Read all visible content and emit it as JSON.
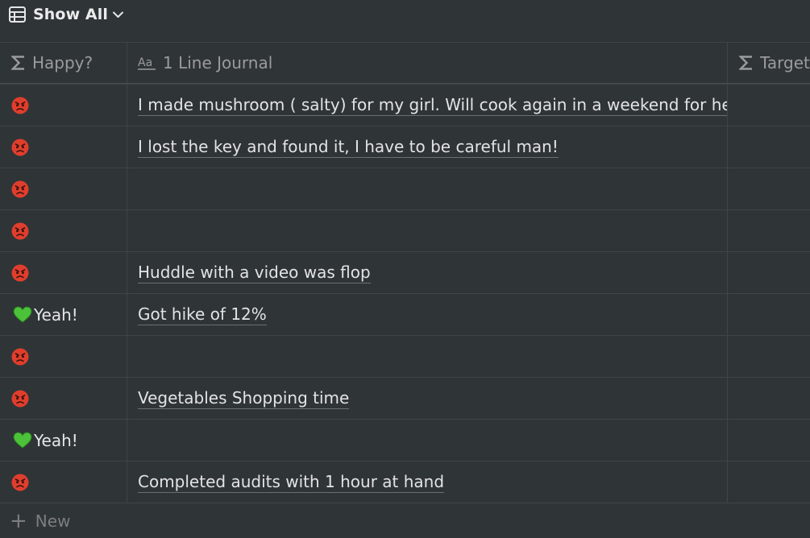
{
  "view": {
    "label": "Show All"
  },
  "columns": {
    "happy": "Happy?",
    "journal": "1 Line Journal",
    "target": "Target"
  },
  "rows": [
    {
      "status": "angry",
      "happy_label": "",
      "journal": "I made mushroom ( salty) for my girl. Will cook again in a weekend for her and"
    },
    {
      "status": "angry",
      "happy_label": "",
      "journal": "I lost the key and found it, I have to be careful man!"
    },
    {
      "status": "angry",
      "happy_label": "",
      "journal": ""
    },
    {
      "status": "angry",
      "happy_label": "",
      "journal": ""
    },
    {
      "status": "angry",
      "happy_label": "",
      "journal": "Huddle with a video was flop"
    },
    {
      "status": "happy",
      "happy_label": "Yeah!",
      "journal": "Got hike of 12%"
    },
    {
      "status": "angry",
      "happy_label": "",
      "journal": ""
    },
    {
      "status": "angry",
      "happy_label": "",
      "journal": "Vegetables Shopping time"
    },
    {
      "status": "happy",
      "happy_label": "Yeah!",
      "journal": ""
    },
    {
      "status": "angry",
      "happy_label": "",
      "journal": "Completed audits with 1 hour at hand"
    }
  ],
  "new_row": {
    "label": "New"
  },
  "colors": {
    "background": "#2f3437",
    "angry_face": "#e03e2d",
    "heart": "#4cc23a"
  }
}
